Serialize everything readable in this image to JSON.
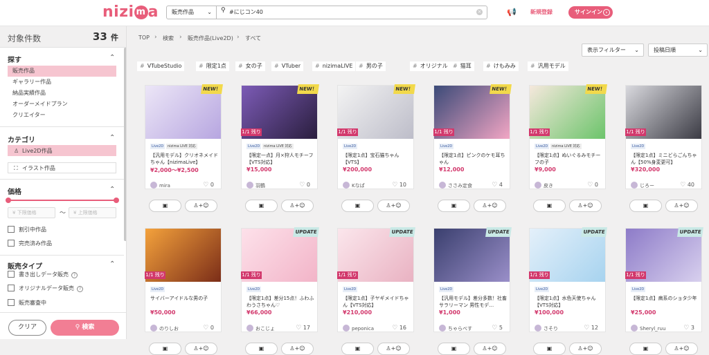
{
  "header": {
    "logo": "nizima",
    "search_category": "販売作品",
    "search_value": "#にじコン40",
    "register": "新規登録",
    "signin": "サインイン"
  },
  "sidebar": {
    "count_label": "対象件数",
    "count_value": "33",
    "count_unit": "件",
    "explore_title": "探す",
    "explore_items": [
      "販売作品",
      "ギャラリー作品",
      "納品実績作品",
      "オーダーメイドプラン",
      "クリエイター"
    ],
    "category_title": "カテゴリ",
    "categories": [
      "Live2D作品",
      "イラスト作品"
    ],
    "price_title": "価格",
    "price_min_placeholder": "下限価格",
    "price_max_placeholder": "上限価格",
    "price_options": [
      "割引中作品",
      "完売済み作品"
    ],
    "type_title": "販売タイプ",
    "type_options": [
      "書き出しデータ販売",
      "オリジナルデータ販売",
      "販売審査中"
    ],
    "clear": "クリア",
    "search": "検索"
  },
  "breadcrumb": [
    "TOP",
    "検索",
    "販売作品(Live2D)",
    "すべて"
  ],
  "filters": {
    "display": "表示フィルター",
    "sort": "投稿日順"
  },
  "tags": [
    "VTubeStudio",
    "限定1点",
    "女の子",
    "VTuber",
    "nizimaLIVE",
    "男の子",
    "オリジナル",
    "猫耳",
    "けもみみ",
    "汎用モデル"
  ],
  "cards": [
    {
      "title": "【汎用モデル】クリオネメイドちゃん【nizimaLive】",
      "price": "¥2,000〜¥2,500",
      "seller": "mira",
      "likes": "0",
      "new": true,
      "update": false,
      "limited": false,
      "nizima": true
    },
    {
      "title": "【限定一点】月×狩人モチーフ【VTS対応】",
      "price": "¥15,000",
      "seller": "羽鶴",
      "likes": "0",
      "new": true,
      "update": false,
      "limited": true,
      "nizima": true
    },
    {
      "title": "【限定1点】宝石猫ちゃん【VTS】",
      "price": "¥200,000",
      "seller": "Kなぱ",
      "likes": "10",
      "new": true,
      "update": false,
      "limited": true,
      "nizima": false
    },
    {
      "title": "【限定1点】ピンクのケモ耳ちゃん",
      "price": "¥12,000",
      "seller": "ささみ定食",
      "likes": "4",
      "new": true,
      "update": false,
      "limited": true,
      "nizima": false
    },
    {
      "title": "【限定1点】ぬいぐるみモチーフの子",
      "price": "¥9,000",
      "seller": "皮き",
      "likes": "0",
      "new": true,
      "update": false,
      "limited": true,
      "nizima": true
    },
    {
      "title": "【限定1点】ミニどらごんちゃん【50%身変更可】",
      "price": "¥320,000",
      "seller": "じろー",
      "likes": "40",
      "new": false,
      "update": false,
      "limited": true,
      "nizima": false
    },
    {
      "title": "サイバーアイドルな男の子",
      "price": "¥50,000",
      "seller": "のりしお",
      "likes": "0",
      "new": false,
      "update": false,
      "limited": true,
      "nizima": false
    },
    {
      "title": "【限定1点】差分15点！ふわふわうさちゃん♡",
      "price": "¥66,000",
      "seller": "おこじょ",
      "likes": "17",
      "new": false,
      "update": true,
      "limited": true,
      "nizima": false
    },
    {
      "title": "【限定1点】子ヤギメイドちゃん【VTS対応】",
      "price": "¥210,000",
      "seller": "peponica",
      "likes": "16",
      "new": false,
      "update": true,
      "limited": true,
      "nizima": false
    },
    {
      "title": "【汎用モデル】差分多数！社畜サラリーマン 男性モデ…",
      "price": "¥1,000",
      "seller": "ちゃらべす",
      "likes": "5",
      "new": false,
      "update": true,
      "limited": false,
      "nizima": false
    },
    {
      "title": "【限定1点】水色天使ちゃん【VTS対応】",
      "price": "¥100,000",
      "seller": "さそり",
      "likes": "12",
      "new": false,
      "update": true,
      "limited": true,
      "nizima": false
    },
    {
      "title": "【限定1点】病系のショタ少年",
      "price": "¥25,000",
      "seller": "Sheryl_ruu",
      "likes": "3",
      "new": false,
      "update": true,
      "limited": true,
      "nizima": false
    }
  ],
  "badges": {
    "new": "NEW！",
    "update": "UPDATE",
    "left_prefix": "1/",
    "left_num": "1",
    "left_suffix": "残り",
    "live2d": "Live2D",
    "nizima_live": "nizima LIVE 対応"
  },
  "colors": {
    "accent": "#e85d7a",
    "limited": "#d2386c",
    "new_badge": "#f2d94b",
    "update_badge": "#c9e9e6"
  }
}
